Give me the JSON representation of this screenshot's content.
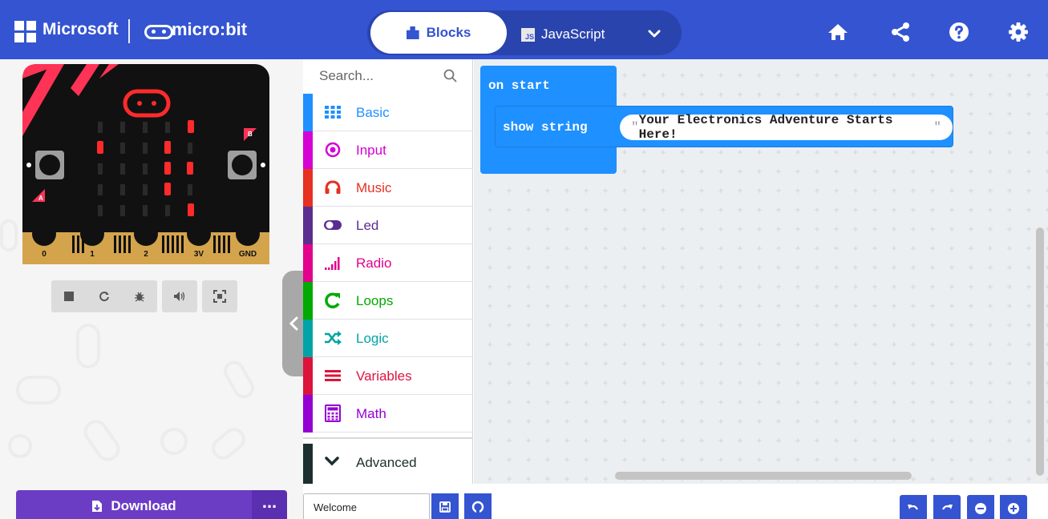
{
  "header": {
    "brand": "Microsoft",
    "product": "micro:bit",
    "tabs": [
      {
        "label": "Blocks",
        "active": true,
        "icon": "puzzle-icon"
      },
      {
        "label": "JavaScript",
        "active": false,
        "icon": "js-icon"
      }
    ],
    "js_badge": "JS",
    "icons": [
      "home-icon",
      "share-icon",
      "help-icon",
      "settings-icon"
    ]
  },
  "simulator": {
    "board_labels": {
      "button_a": "A",
      "button_b": "B"
    },
    "pins": [
      "0",
      "1",
      "2",
      "3V",
      "GND"
    ],
    "controls": [
      "stop-icon",
      "restart-icon",
      "debug-icon",
      "sound-icon",
      "fullscreen-icon"
    ]
  },
  "toolbox": {
    "search_placeholder": "Search...",
    "categories": [
      {
        "label": "Basic",
        "color": "#1e90ff",
        "icon": "grid-icon"
      },
      {
        "label": "Input",
        "color": "#d400d4",
        "icon": "target-icon"
      },
      {
        "label": "Music",
        "color": "#e63022",
        "icon": "headphones-icon"
      },
      {
        "label": "Led",
        "color": "#5c2d91",
        "icon": "toggle-icon"
      },
      {
        "label": "Radio",
        "color": "#e3008c",
        "icon": "signal-icon"
      },
      {
        "label": "Loops",
        "color": "#00aa00",
        "icon": "refresh-icon"
      },
      {
        "label": "Logic",
        "color": "#00a4a6",
        "icon": "shuffle-icon"
      },
      {
        "label": "Variables",
        "color": "#dc143c",
        "icon": "lines-icon"
      },
      {
        "label": "Math",
        "color": "#9400d3",
        "icon": "calculator-icon"
      }
    ],
    "advanced_label": "Advanced"
  },
  "workspace": {
    "on_start_label": "on start",
    "show_string_label": "show string",
    "string_value": "Your Electronics Adventure Starts Here!",
    "quote": "\""
  },
  "bottom": {
    "download_label": "Download",
    "more_label": "...",
    "project_name": "Welcome"
  },
  "colors": {
    "header": "#3454d1",
    "download": "#6b3dc5",
    "block": "#1e90ff",
    "led": "#ff2b2b"
  }
}
